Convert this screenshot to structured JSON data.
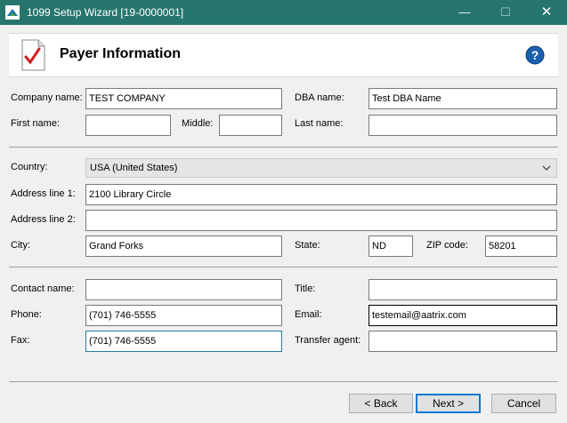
{
  "window": {
    "title": "1099 Setup Wizard [19-0000001]",
    "min_glyph": "—",
    "max_glyph": "☐",
    "close_glyph": "✕",
    "titlebar_color": "#26766e"
  },
  "header": {
    "title": "Payer Information"
  },
  "form": {
    "company_name": {
      "label": "Company name:",
      "value": "TEST COMPANY"
    },
    "dba_name": {
      "label": "DBA name:",
      "value": "Test DBA Name"
    },
    "first_name": {
      "label": "First name:",
      "value": ""
    },
    "middle": {
      "label": "Middle:",
      "value": ""
    },
    "last_name": {
      "label": "Last name:",
      "value": ""
    },
    "country": {
      "label": "Country:",
      "value": "USA (United States)"
    },
    "address1": {
      "label": "Address line 1:",
      "value": "2100 Library Circle"
    },
    "address2": {
      "label": "Address line 2:",
      "value": ""
    },
    "city": {
      "label": "City:",
      "value": "Grand Forks"
    },
    "state": {
      "label": "State:",
      "value": "ND"
    },
    "zip": {
      "label": "ZIP code:",
      "value": "58201"
    },
    "contact_name": {
      "label": "Contact name:",
      "value": ""
    },
    "title": {
      "label": "Title:",
      "value": ""
    },
    "phone": {
      "label": "Phone:",
      "value": "(701) 746-5555"
    },
    "email": {
      "label": "Email:",
      "value": "testemail@aatrix.com"
    },
    "fax": {
      "label": "Fax:",
      "value": "(701) 746-5555"
    },
    "transfer_agent": {
      "label": "Transfer agent:",
      "value": ""
    }
  },
  "buttons": {
    "back": "< Back",
    "next": "Next >",
    "cancel": "Cancel"
  }
}
